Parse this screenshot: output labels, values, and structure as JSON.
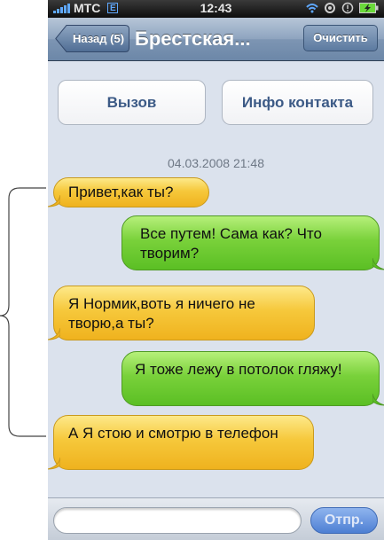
{
  "status_bar": {
    "carrier": "MTC",
    "network_type": "E",
    "time": "12:43",
    "icons": [
      "wifi-icon",
      "lock-rotation-icon",
      "alarm-icon",
      "battery-charging-icon"
    ]
  },
  "nav": {
    "back_label": "Назад (5)",
    "title": "Брестская...",
    "clear_label": "Очистить"
  },
  "actions": {
    "call_label": "Вызов",
    "contact_info_label": "Инфо контакта"
  },
  "conversation": {
    "timestamp": "04.03.2008 21:48",
    "messages": [
      {
        "direction": "incoming",
        "text": "Привет,как ты?"
      },
      {
        "direction": "outgoing",
        "text": "Все путем! Сама как? Что творим?"
      },
      {
        "direction": "incoming",
        "text": "Я Нормик,воть я ничего не творю,а ты?"
      },
      {
        "direction": "outgoing",
        "text": "Я тоже лежу в потолок гляжу!"
      },
      {
        "direction": "incoming",
        "text": "А Я стою и смотрю в телефон"
      }
    ]
  },
  "composer": {
    "input_value": "",
    "send_label": "Отпр."
  },
  "colors": {
    "incoming_bubble": "#f6c83b",
    "outgoing_bubble": "#79d13a",
    "background": "#dbe2ed"
  }
}
